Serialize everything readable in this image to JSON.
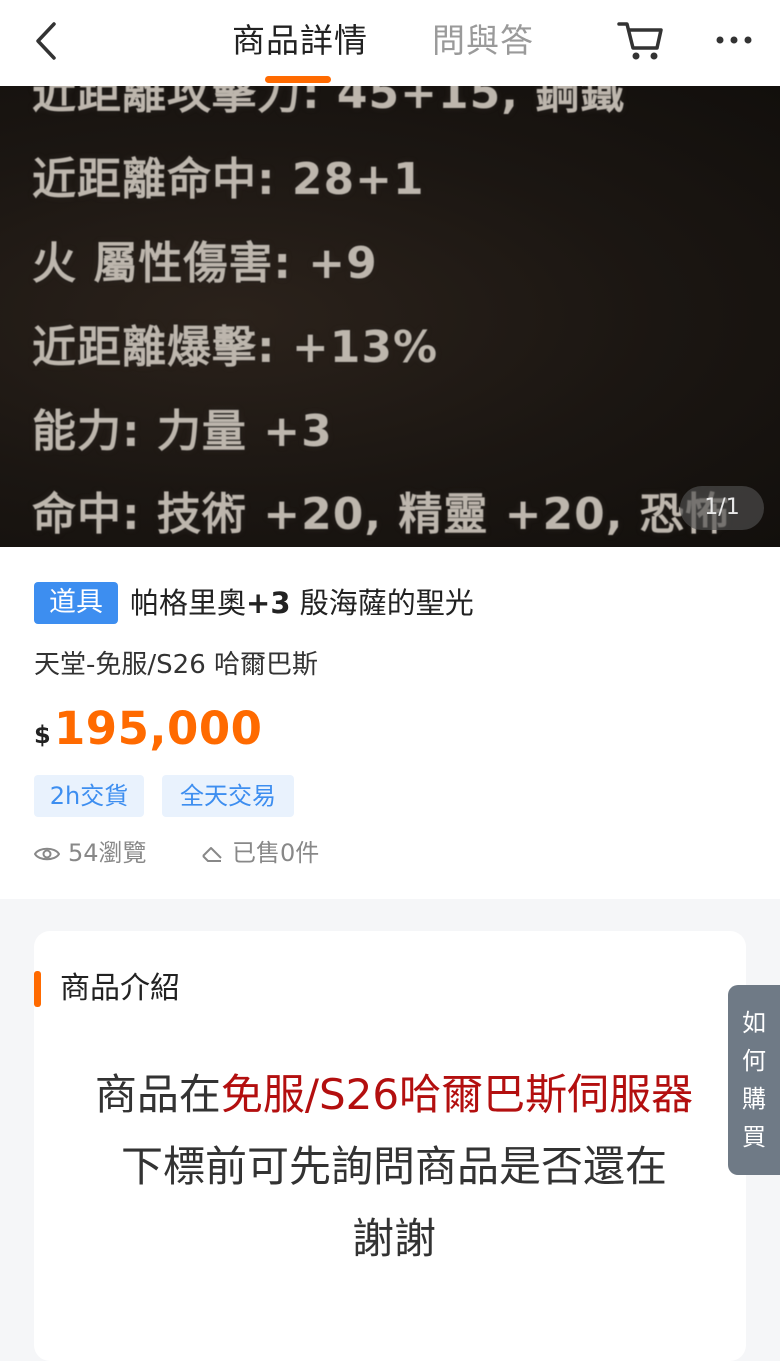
{
  "header": {
    "tabs": [
      {
        "label": "商品詳情",
        "active": true
      },
      {
        "label": "問與答",
        "active": false
      }
    ],
    "icons": [
      "back-arrow-icon",
      "cart-icon",
      "more-icon"
    ],
    "accent_color": "#ff6a00"
  },
  "photo": {
    "text_lines": [
      "近距離攻擊力: 45+15, 鋼鐵",
      "近距離命中: 28+1",
      "火 屬性傷害: +9",
      "近距離爆擊: +13%",
      "能力: 力量 +3",
      "命中: 技術 +20, 精靈 +20, 恐怖"
    ],
    "counter": "1/1"
  },
  "product": {
    "category": "道具",
    "title_prefix": "帕格里奧",
    "title_bold": "+3",
    "title_suffix": " 殷海薩的聖光",
    "server": "天堂-免服/S26 哈爾巴斯",
    "currency_symbol": "$",
    "price": "195,000",
    "tags": [
      "2h交貨",
      "全天交易"
    ],
    "views": "54瀏覽",
    "sold": "已售0件"
  },
  "description": {
    "heading": "商品介紹",
    "line1_normal": "商品在",
    "line1_red": "免服/S26哈爾巴斯伺服器",
    "line2": "下標前可先詢問商品是否還在",
    "line3": "謝謝"
  },
  "side_button": {
    "chars": [
      "如",
      "何",
      "購",
      "買"
    ]
  }
}
